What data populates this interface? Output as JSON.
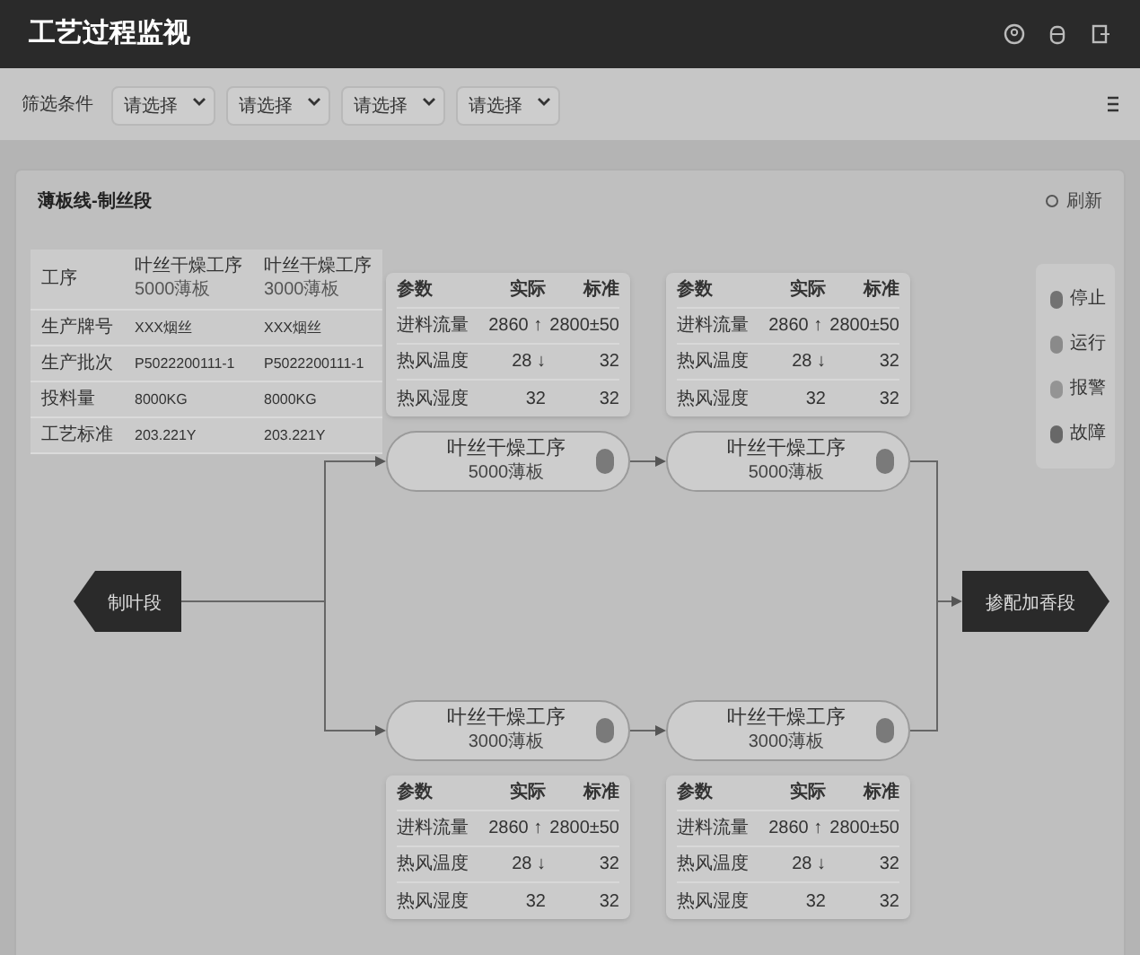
{
  "header": {
    "title": "工艺过程监视"
  },
  "filter_bar": {
    "label": "筛选条件",
    "selects": [
      {
        "placeholder": "请选择"
      },
      {
        "placeholder": "请选择"
      },
      {
        "placeholder": "请选择"
      },
      {
        "placeholder": "请选择"
      }
    ]
  },
  "panel": {
    "title": "薄板线-制丝段",
    "refresh": "刷新"
  },
  "process_table": {
    "header": "工序",
    "processes": [
      {
        "name": "叶丝干燥工序",
        "capacity": "5000薄板"
      },
      {
        "name": "叶丝干燥工序",
        "capacity": "3000薄板"
      }
    ],
    "rows": [
      {
        "label": "生产牌号",
        "values": [
          "XXX烟丝",
          "XXX烟丝"
        ]
      },
      {
        "label": "生产批次",
        "values": [
          "P5022200111-1",
          "P5022200111-1"
        ]
      },
      {
        "label": "投料量",
        "values": [
          "8000KG",
          "8000KG"
        ]
      },
      {
        "label": "工艺标准",
        "values": [
          "203.221Y",
          "203.221Y"
        ]
      }
    ]
  },
  "flow": {
    "start": "制叶段",
    "end": "掺配加香段",
    "nodes": [
      {
        "name": "叶丝干燥工序",
        "capacity": "5000薄板",
        "color": "#7a7a7a",
        "params": {
          "columns": [
            "参数",
            "实际",
            "标准"
          ],
          "rows": [
            [
              "进料流量",
              "2860 ↑",
              "2800±50"
            ],
            [
              "热风温度",
              "28 ↓",
              "32"
            ],
            [
              "热风湿度",
              "32",
              "32"
            ]
          ]
        }
      },
      {
        "name": "叶丝干燥工序",
        "capacity": "5000薄板",
        "color": "#7a7a7a",
        "params": {
          "columns": [
            "参数",
            "实际",
            "标准"
          ],
          "rows": [
            [
              "进料流量",
              "2860 ↑",
              "2800±50"
            ],
            [
              "热风温度",
              "28 ↓",
              "32"
            ],
            [
              "热风湿度",
              "32",
              "32"
            ]
          ]
        }
      },
      {
        "name": "叶丝干燥工序",
        "capacity": "3000薄板",
        "color": "#7a7a7a",
        "params": {
          "columns": [
            "参数",
            "实际",
            "标准"
          ],
          "rows": [
            [
              "进料流量",
              "2860 ↑",
              "2800±50"
            ],
            [
              "热风温度",
              "28 ↓",
              "32"
            ],
            [
              "热风湿度",
              "32",
              "32"
            ]
          ]
        }
      },
      {
        "name": "叶丝干燥工序",
        "capacity": "3000薄板",
        "color": "#7a7a7a",
        "params": {
          "columns": [
            "参数",
            "实际",
            "标准"
          ],
          "rows": [
            [
              "进料流量",
              "2860 ↑",
              "2800±50"
            ],
            [
              "热风温度",
              "28 ↓",
              "32"
            ],
            [
              "热风湿度",
              "32",
              "32"
            ]
          ]
        }
      }
    ]
  },
  "legend": [
    {
      "label": "停止",
      "color": "#727272"
    },
    {
      "label": "运行",
      "color": "#8a8a8a"
    },
    {
      "label": "报警",
      "color": "#949494"
    },
    {
      "label": "故障",
      "color": "#686868"
    }
  ]
}
